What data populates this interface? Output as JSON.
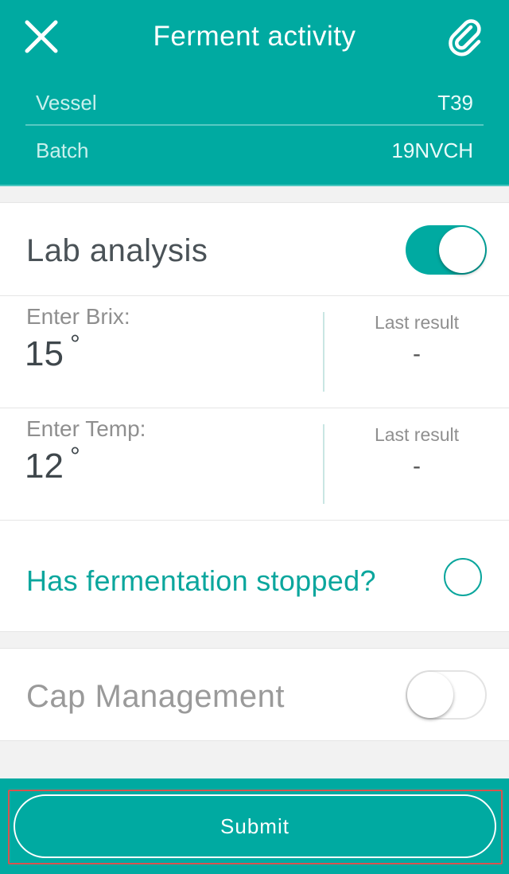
{
  "header": {
    "title": "Ferment activity",
    "close_icon": "close-icon",
    "attach_icon": "paperclip-icon",
    "background_color": "#00aaa1",
    "rows": [
      {
        "label": "Vessel",
        "value": "T39"
      },
      {
        "label": "Batch",
        "value": "19NVCH"
      }
    ]
  },
  "lab_analysis": {
    "title": "Lab analysis",
    "toggle_on": true,
    "measurements": [
      {
        "label": "Enter Brix:",
        "value": "15",
        "unit": "°",
        "last_result_label": "Last result",
        "last_result_value": "-"
      },
      {
        "label": "Enter Temp:",
        "value": "12",
        "unit": "°",
        "last_result_label": "Last result",
        "last_result_value": "-"
      }
    ],
    "fermentation_question": "Has fermentation stopped?",
    "fermentation_checked": false
  },
  "cap_management": {
    "title": "Cap Management",
    "toggle_on": false
  },
  "footer": {
    "submit_label": "Submit"
  },
  "colors": {
    "accent": "#00aaa1",
    "question_text": "#0ba69d",
    "highlight_border": "#d9534f"
  }
}
